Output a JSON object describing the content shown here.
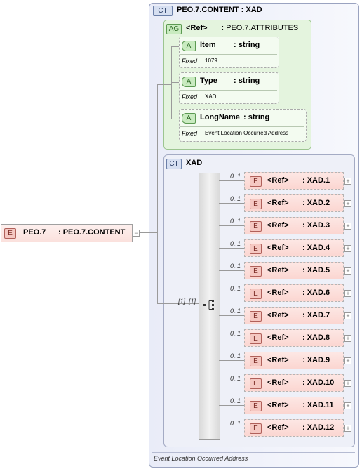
{
  "root": {
    "badge": "E",
    "name": "PEO.7",
    "type": ": PEO.7.CONTENT"
  },
  "complex_type": {
    "badge": "CT",
    "title": "PEO.7.CONTENT : XAD"
  },
  "attr_group": {
    "badge": "AG",
    "ref": "<Ref>",
    "type": ": PEO.7.ATTRIBUTES"
  },
  "attributes": [
    {
      "badge": "A",
      "name": "Item",
      "type": ": string",
      "fixed_label": "Fixed",
      "fixed_value": "1079"
    },
    {
      "badge": "A",
      "name": "Type",
      "type": ": string",
      "fixed_label": "Fixed",
      "fixed_value": "XAD"
    },
    {
      "badge": "A",
      "name": "LongName",
      "type": ": string",
      "fixed_label": "Fixed",
      "fixed_value": "Event Location Occurred Address"
    }
  ],
  "xad": {
    "badge": "CT",
    "title": "XAD",
    "occurrence": "[1]..[1]"
  },
  "elements": [
    {
      "badge": "E",
      "ref": "<Ref>",
      "type": ": XAD.1",
      "occ": "0..1"
    },
    {
      "badge": "E",
      "ref": "<Ref>",
      "type": ": XAD.2",
      "occ": "0..1"
    },
    {
      "badge": "E",
      "ref": "<Ref>",
      "type": ": XAD.3",
      "occ": "0..1"
    },
    {
      "badge": "E",
      "ref": "<Ref>",
      "type": ": XAD.4",
      "occ": "0..1"
    },
    {
      "badge": "E",
      "ref": "<Ref>",
      "type": ": XAD.5",
      "occ": "0..1"
    },
    {
      "badge": "E",
      "ref": "<Ref>",
      "type": ": XAD.6",
      "occ": "0..1"
    },
    {
      "badge": "E",
      "ref": "<Ref>",
      "type": ": XAD.7",
      "occ": "0..1"
    },
    {
      "badge": "E",
      "ref": "<Ref>",
      "type": ": XAD.8",
      "occ": "0..1"
    },
    {
      "badge": "E",
      "ref": "<Ref>",
      "type": ": XAD.9",
      "occ": "0..1"
    },
    {
      "badge": "E",
      "ref": "<Ref>",
      "type": ": XAD.10",
      "occ": "0..1"
    },
    {
      "badge": "E",
      "ref": "<Ref>",
      "type": ": XAD.11",
      "occ": "0..1"
    },
    {
      "badge": "E",
      "ref": "<Ref>",
      "type": ": XAD.12",
      "occ": "0..1"
    }
  ],
  "footer": "Event Location Occurred Address",
  "icons": {
    "sequence": "sequence-icon",
    "expand": "plus-icon"
  }
}
